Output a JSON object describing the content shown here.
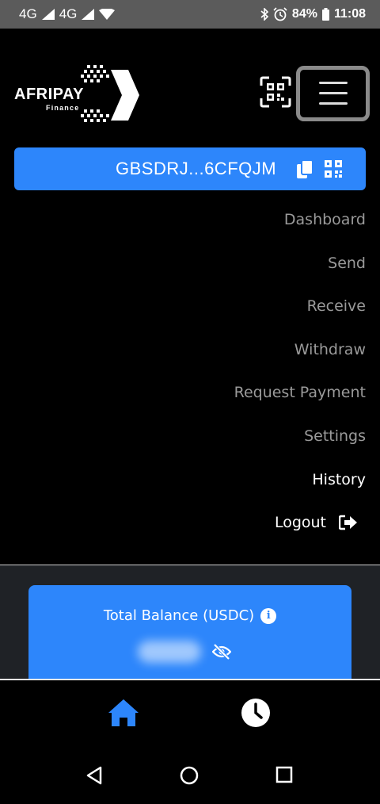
{
  "status_bar": {
    "network_1": "4G",
    "network_2": "4G",
    "battery": "84%",
    "time": "11:08"
  },
  "header": {
    "logo_text": "AFRIPAY",
    "logo_subtext": "Finance",
    "scan_icon": "qr-scan-icon",
    "menu_icon": "hamburger-icon"
  },
  "wallet": {
    "address": "GBSDRJ...6CFQJM",
    "copy_icon": "copy-icon",
    "qr_icon": "qr-code-icon",
    "accent_color": "#2d86fb"
  },
  "menu": {
    "items": [
      {
        "label": "Dashboard",
        "active": false
      },
      {
        "label": "Send",
        "active": false
      },
      {
        "label": "Receive",
        "active": false
      },
      {
        "label": "Withdraw",
        "active": false
      },
      {
        "label": "Request Payment",
        "active": false
      },
      {
        "label": "Settings",
        "active": false
      },
      {
        "label": "History",
        "active": true
      },
      {
        "label": "Logout",
        "active": true,
        "icon": "logout-icon"
      }
    ]
  },
  "balance": {
    "label": "Total Balance (USDC)",
    "value": "",
    "hidden": true,
    "info_icon": "info-icon",
    "toggle_icon": "eye-off-icon"
  },
  "tabs": [
    {
      "name": "home",
      "icon": "home-icon",
      "color": "#2d86fb"
    },
    {
      "name": "history",
      "icon": "clock-icon",
      "color": "#ffffff"
    }
  ]
}
